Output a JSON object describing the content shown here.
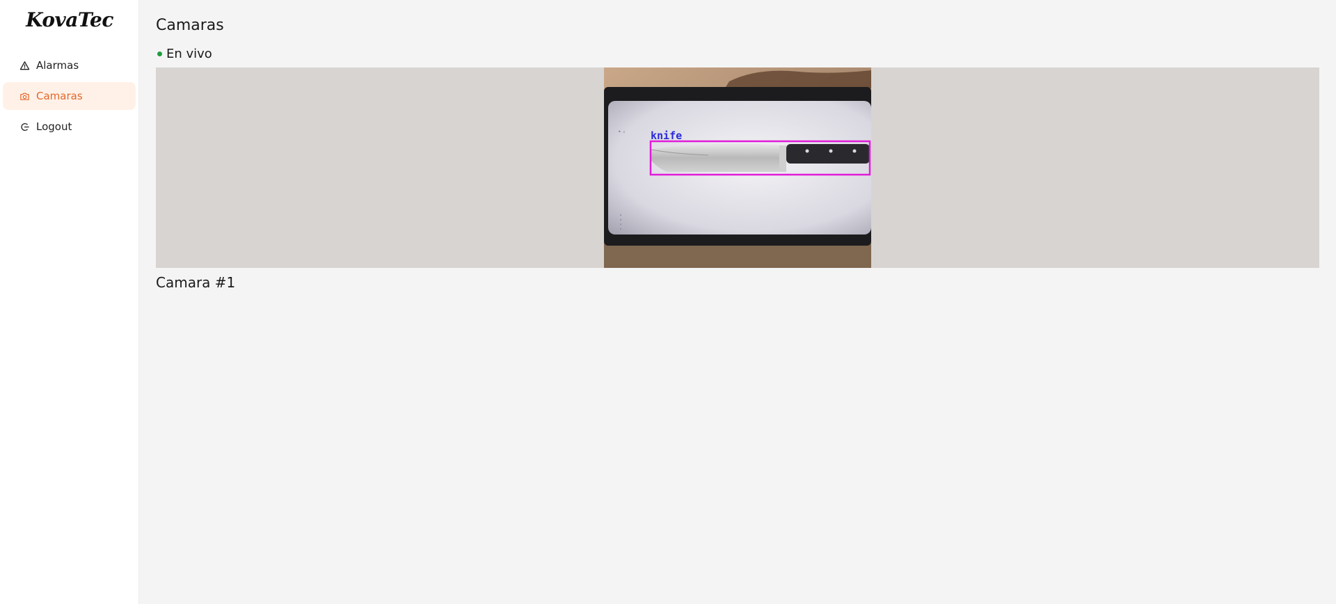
{
  "app": {
    "logo": "KovaTec"
  },
  "sidebar": {
    "items": [
      {
        "label": "Alarmas",
        "icon": "warning-triangle-icon",
        "active": false
      },
      {
        "label": "Camaras",
        "icon": "camera-icon",
        "active": true
      },
      {
        "label": "Logout",
        "icon": "logout-icon",
        "active": false
      }
    ]
  },
  "main": {
    "title": "Camaras",
    "status": "En vivo",
    "cameras": [
      {
        "name": "Camara #1",
        "detection_label": "knife"
      }
    ]
  },
  "colors": {
    "accent": "#e0682c",
    "accent_bg": "#fff1e7",
    "live": "#1f9d3e",
    "detection_box": "#e01bd8",
    "detection_text": "#2a2ad8"
  }
}
